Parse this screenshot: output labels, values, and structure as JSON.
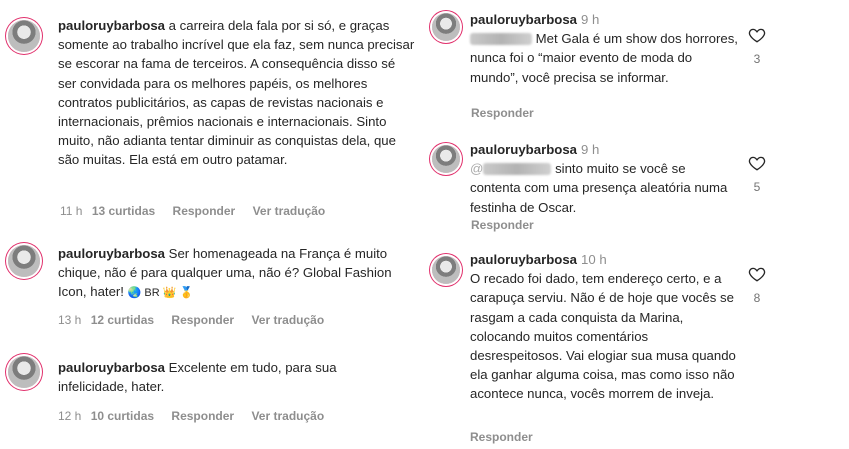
{
  "left": [
    {
      "user": "pauloruybarbosa",
      "text": "a carreira dela fala por si só, e graças somente ao trabalho incrível que ela faz, sem nunca precisar se escorar na fama de terceiros. A consequência disso sé ser convidada para os melhores papéis, os melhores contratos publicitários, as capas de revistas nacionais e internacionais, prêmios nacionais e internacionais. Sinto muito, não adianta tentar diminuir as conquistas dela, que são muitas. Ela está em outro patamar.",
      "time": "11 h",
      "likes": "13 curtidas",
      "reply": "Responder",
      "translate": "Ver tradução"
    },
    {
      "user": "pauloruybarbosa",
      "text": "Ser homenageada na França é muito chique, não é para qualquer uma, não é? Global Fashion Icon, hater!",
      "emoji": "🌏 BR 👑 🥇",
      "time": "13 h",
      "likes": "12 curtidas",
      "reply": "Responder",
      "translate": "Ver tradução"
    },
    {
      "user": "pauloruybarbosa",
      "text": "Excelente em tudo, para sua infelicidade, hater.",
      "time": "12 h",
      "likes": "10 curtidas",
      "reply": "Responder",
      "translate": "Ver tradução"
    }
  ],
  "right": [
    {
      "user": "pauloruybarbosa",
      "time": "9 h",
      "text": "Met Gala é um show dos horrores, nunca foi o “maior evento de moda do mundo”, você precisa se informar.",
      "reply": "Responder",
      "like_count": "3"
    },
    {
      "user": "pauloruybarbosa",
      "time": "9 h",
      "mention_prefix": "@",
      "text": "sinto muito se você se contenta com uma presença aleatória numa festinha de Oscar.",
      "reply": "Responder",
      "like_count": "5"
    },
    {
      "user": "pauloruybarbosa",
      "time": "10 h",
      "text": "O recado foi dado, tem endereço certo, e a carapuça serviu. Não é de hoje que vocês se rasgam a cada conquista da Marina, colocando muitos comentários desrespeitosos. Vai elogiar sua musa quando ela ganhar alguma coisa, mas como isso não acontece nunca, vocês morrem de inveja.",
      "reply": "Responder",
      "like_count": "8"
    }
  ],
  "icons": {
    "heart": "heart-outline-icon",
    "avatar": "profile-avatar"
  },
  "colors": {
    "text": "#262626",
    "muted": "#8e8e8e",
    "ring": "#e1306c"
  }
}
